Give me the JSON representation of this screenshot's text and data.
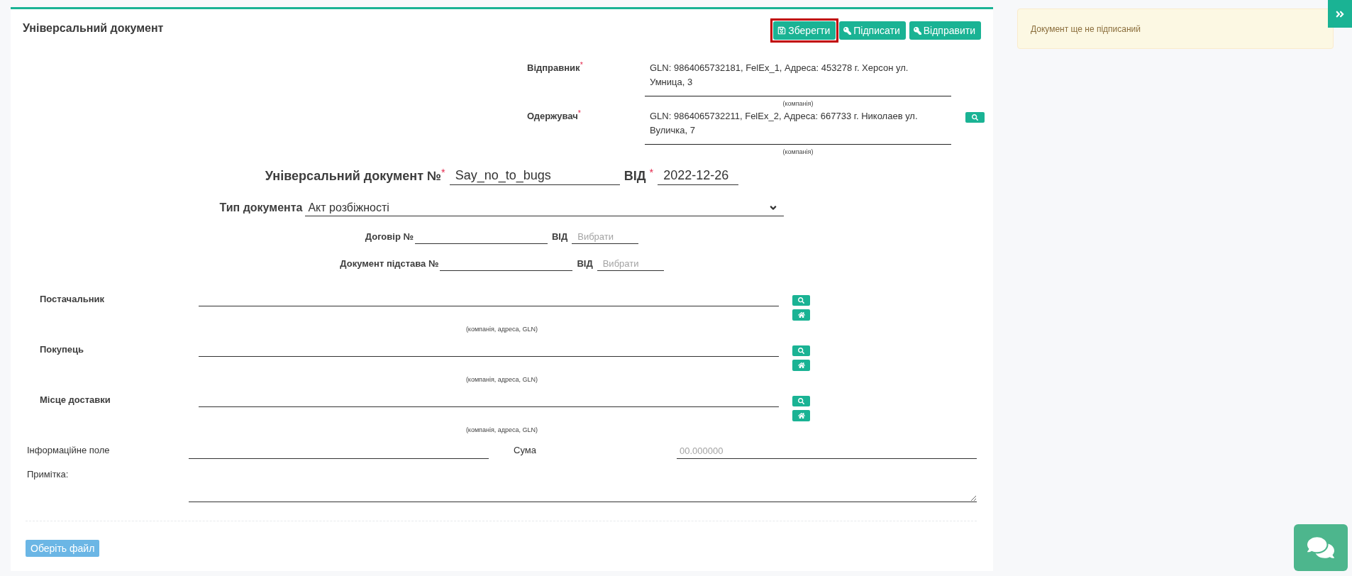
{
  "header": {
    "title": "Універсальний документ",
    "buttons": [
      {
        "label": "Зберегти",
        "highlighted": true
      },
      {
        "label": "Підписати",
        "highlighted": false
      },
      {
        "label": "Відправити",
        "highlighted": false
      }
    ]
  },
  "parties": [
    {
      "label": "Відправник$^{*}$",
      "value": "GLN: 9864065732181, FelEx_1, Адреса: 453278 г. Херсон ул. Умница, 3",
      "hint": "(компанія)",
      "search_button": false
    },
    {
      "label": "Одержувач$^{*}$",
      "value": "GLN: 9864065732211, FelEx_2, Адреса: 667733 г. Николаев ул. Вуличка, 7",
      "hint": "(компанія)",
      "search_button": true
    }
  ],
  "document_number": {
    "label": "Універсальний документ №$^{*}$",
    "value": "Say_no_to_bugs",
    "date_label": "ВІД $^{*}$",
    "date": "2022-12-26"
  },
  "document_type": {
    "label": "Тип документа",
    "value": "Акт розбіжності"
  },
  "references": [
    {
      "label": "Договір №",
      "date_label": "ВІД",
      "date_field": {
        "placeholder": "Вибрати"
      }
    },
    {
      "label": "Документ підстава №",
      "date_label": "ВІД",
      "date_field": {
        "placeholder": "Вибрати"
      }
    }
  ],
  "companies": [
    {
      "label": "Постачальник",
      "hint": "(компанія, адреса, GLN)"
    },
    {
      "label": "Покупець",
      "hint": "(компанія, адреса, GLN)"
    },
    {
      "label": "Місце доставки",
      "hint": "(компанія, адреса, GLN)"
    }
  ],
  "info_field": {
    "label": "Інформаційне поле"
  },
  "sum": {
    "label": "Сума",
    "placeholder": "00.000000"
  },
  "note": {
    "label": "Примітка:"
  },
  "file_button": {
    "label": "Оберіть файл"
  },
  "status_alert": {
    "text": "Документ ще не підписаний"
  }
}
